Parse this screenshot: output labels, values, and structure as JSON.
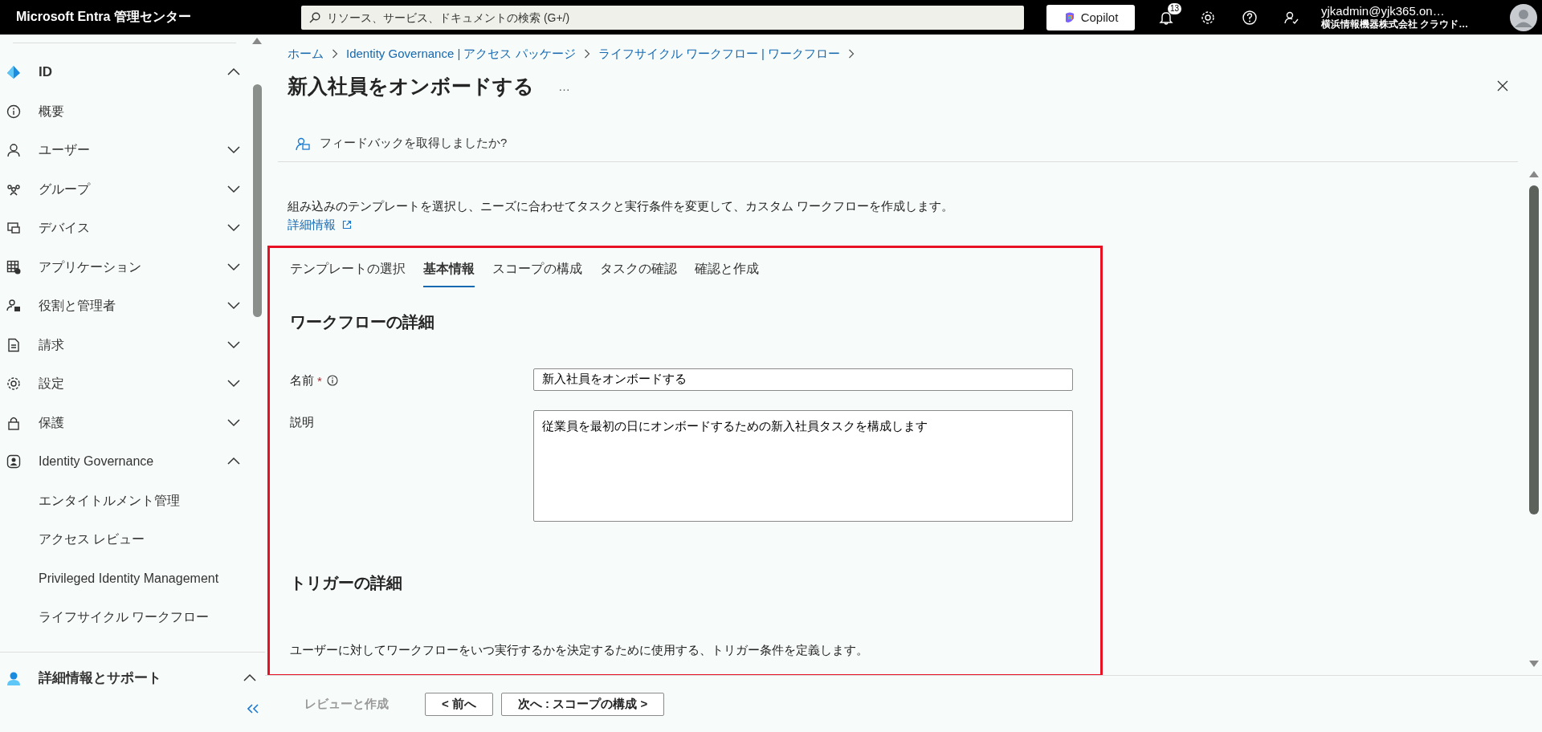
{
  "top_bar": {
    "brand": "Microsoft Entra 管理センター",
    "search_placeholder": "リソース、サービス、ドキュメントの検索 (G+/)",
    "copilot_label": "Copilot",
    "notification_count": "13",
    "account": {
      "email": "yjkadmin@yjk365.on…",
      "org": "横浜情報機器株式会社 クラウド…"
    }
  },
  "sidebar": {
    "items": [
      {
        "label": "ID",
        "kind": "group",
        "expanded": true,
        "children": [
          {
            "label": "概要",
            "kind": "link"
          },
          {
            "label": "ユーザー",
            "kind": "group",
            "expanded": false
          },
          {
            "label": "グループ",
            "kind": "group",
            "expanded": false
          },
          {
            "label": "デバイス",
            "kind": "group",
            "expanded": false
          },
          {
            "label": "アプリケーション",
            "kind": "group",
            "expanded": false
          },
          {
            "label": "役割と管理者",
            "kind": "group",
            "expanded": false
          },
          {
            "label": "請求",
            "kind": "group",
            "expanded": false
          },
          {
            "label": "設定",
            "kind": "group",
            "expanded": false
          },
          {
            "label": "保護",
            "kind": "group",
            "expanded": false
          },
          {
            "label": "Identity Governance",
            "kind": "group",
            "expanded": true,
            "children": [
              {
                "label": "エンタイトルメント管理",
                "kind": "link"
              },
              {
                "label": "アクセス レビュー",
                "kind": "link"
              },
              {
                "label": "Privileged Identity Management",
                "kind": "link"
              },
              {
                "label": "ライフサイクル ワークフロー",
                "kind": "link"
              }
            ]
          }
        ]
      }
    ],
    "footer_item": {
      "label": "詳細情報とサポート",
      "expanded": true
    }
  },
  "breadcrumb": [
    "ホーム",
    "Identity Governance | アクセス パッケージ",
    "ライフサイクル ワークフロー | ワークフロー"
  ],
  "page_title": "新入社員をオンボードする",
  "more_label": "…",
  "feedback_label": "フィードバックを取得しましたか?",
  "intro": "組み込みのテンプレートを選択し、ニーズに合わせてタスクと実行条件を変更して、カスタム ワークフローを作成します。",
  "learn_more": "詳細情報",
  "wizard": {
    "highlighted": true,
    "tabs": [
      {
        "label": "テンプレートの選択",
        "selected": false
      },
      {
        "label": "基本情報",
        "selected": true
      },
      {
        "label": "スコープの構成",
        "selected": false
      },
      {
        "label": "タスクの確認",
        "selected": false
      },
      {
        "label": "確認と作成",
        "selected": false
      }
    ],
    "sections": [
      {
        "heading": "ワークフローの詳細",
        "fields": [
          {
            "label": "名前",
            "required_mark": "*",
            "kind": "input",
            "value": "新入社員をオンボードする"
          },
          {
            "label": "説明",
            "kind": "textarea",
            "value": "従業員を最初の日にオンボードするための新入社員タスクを構成します"
          }
        ]
      },
      {
        "heading": "トリガーの詳細",
        "text": "ユーザーに対してワークフローをいつ実行するかを決定するために使用する、トリガー条件を定義します。"
      }
    ]
  },
  "footer_buttons": [
    {
      "label": "レビューと作成",
      "disabled": true
    },
    {
      "label": "< 前へ",
      "disabled": false
    },
    {
      "label": "次へ : スコープの構成 >",
      "disabled": false
    }
  ]
}
